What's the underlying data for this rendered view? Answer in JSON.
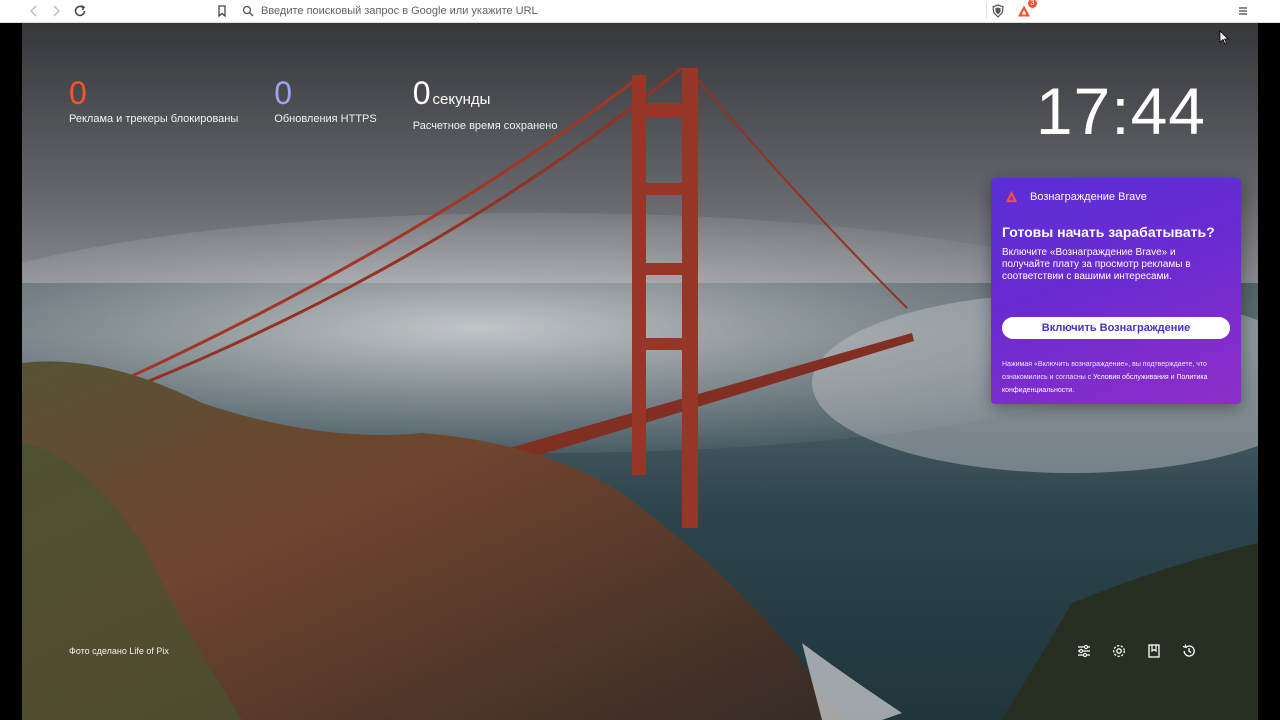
{
  "toolbar": {
    "back_icon": "back-arrow-icon",
    "forward_icon": "forward-arrow-icon",
    "reload_icon": "reload-icon",
    "bookmark_icon": "bookmark-icon",
    "search_icon": "search-icon",
    "url_placeholder": "Введите поисковый запрос в Google или укажите URL",
    "url_value": "",
    "shields_icon": "brave-shields-icon",
    "rewards_icon": "brave-rewards-icon",
    "rewards_badge": "3",
    "menu_icon": "hamburger-menu-icon"
  },
  "stats": [
    {
      "value": "0",
      "unit": "",
      "label": "Реклама и трекеры блокированы",
      "color": "#fb542b"
    },
    {
      "value": "0",
      "unit": "",
      "label": "Обновления HTTPS",
      "color": "#a0a5eb"
    },
    {
      "value": "0",
      "unit": "секунды",
      "label": "Расчетное время сохранено",
      "color": "#ffffff"
    }
  ],
  "clock": "17:44",
  "rewards_card": {
    "header": "Вознаграждение Brave",
    "title": "Готовы начать зарабатывать?",
    "description": "Включите «Вознаграждение Brave» и получайте плату за просмотр рекламы в соответствии с вашими интересами.",
    "button": "Включить Вознаграждение",
    "legal_prefix": "Нажимая «Включить вознаграждение», вы подтверждаете, что ознакомились и согласны с ",
    "legal_tos": "Условия обслуживания",
    "legal_and": " и ",
    "legal_privacy": "Политика конфиденциальности",
    "legal_suffix": "."
  },
  "photo_credit": "Фото сделано Life of Pix",
  "bottom_actions": [
    "customize-icon",
    "settings-icon",
    "bookmarks-icon",
    "history-icon"
  ],
  "colors": {
    "accent_orange": "#fb542b",
    "accent_lavender": "#a0a5eb",
    "rewards_gradient_start": "#5b2fd6",
    "rewards_gradient_end": "#8f2ec9"
  }
}
